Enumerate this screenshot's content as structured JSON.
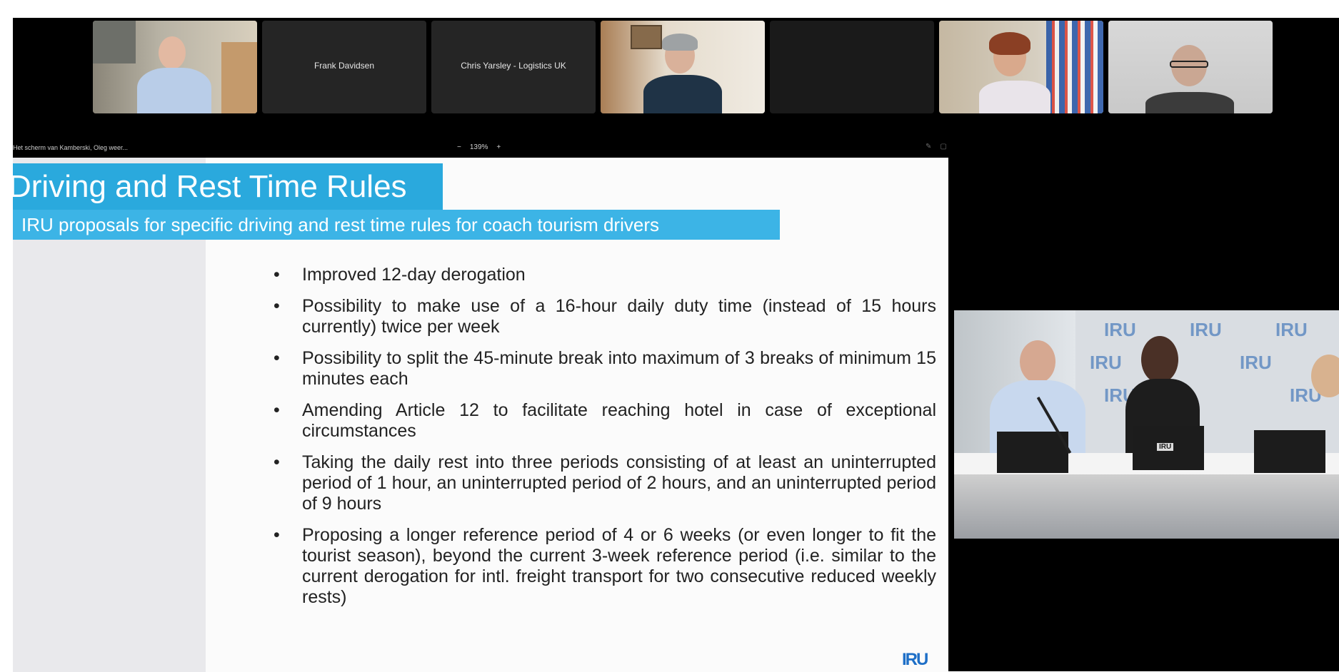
{
  "participants": [
    {
      "id": "p1",
      "name": "",
      "type": "video"
    },
    {
      "id": "p2",
      "name": "Frank Davidsen",
      "type": "name"
    },
    {
      "id": "p3",
      "name": "Chris Yarsley - Logistics UK",
      "type": "name"
    },
    {
      "id": "p4",
      "name": "",
      "type": "video"
    },
    {
      "id": "p5",
      "name": "",
      "type": "blank"
    },
    {
      "id": "p6",
      "name": "",
      "type": "video"
    },
    {
      "id": "p7",
      "name": "",
      "type": "video"
    }
  ],
  "share": {
    "label": "Het scherm van Kamberski, Oleg weer...",
    "zoom_out": "−",
    "zoom_level": "139%",
    "zoom_in": "+"
  },
  "slide": {
    "title": "Driving and Rest Time Rules",
    "subtitle": "IRU proposals for specific driving and rest time rules for coach tourism drivers",
    "bullet_char": "•",
    "bullets": [
      "Improved 12-day derogation",
      "Possibility to make use of a 16-hour daily duty time (instead of 15 hours currently) twice per week",
      "Possibility to split the 45-minute break into maximum of 3 breaks of minimum 15 minutes each",
      "Amending Article 12 to facilitate reaching hotel in case of exceptional circumstances",
      "Taking the daily rest into three periods consisting of at least an uninterrupted period of 1 hour, an uninterrupted period of 2 hours, and an uninterrupted period of 9 hours",
      "Proposing a longer reference period of 4 or 6 weeks (or even longer to fit the tourist season), beyond the current 3-week reference period (i.e. similar to the current derogation for intl. freight transport for two consecutive reduced weekly rests)"
    ],
    "logo": "IRU"
  },
  "speaker_video": {
    "backdrop_logo": "IRU",
    "laptop_sticker": "IRU"
  },
  "colors": {
    "title_bg": "#2aa9dd",
    "subtitle_bg": "#3cb4e6",
    "background": "#000000",
    "tile_bg": "#252525"
  }
}
